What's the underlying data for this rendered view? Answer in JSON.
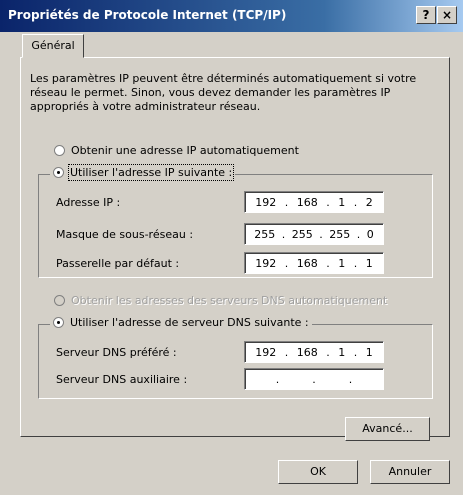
{
  "window": {
    "title": "Propriétés de Protocole Internet (TCP/IP)",
    "help_label": "?",
    "close_label": "×"
  },
  "tabs": [
    {
      "label": "Général"
    }
  ],
  "description": "Les paramètres IP peuvent être déterminés automatiquement si votre réseau le permet. Sinon, vous devez demander les paramètres IP appropriés à votre administrateur réseau.",
  "ip_section": {
    "auto_label": "Obtenir une adresse IP automatiquement",
    "manual_label": "Utiliser l'adresse IP suivante :",
    "fields": [
      {
        "label": "Adresse IP :",
        "octets": [
          "192",
          "168",
          "1",
          "2"
        ]
      },
      {
        "label": "Masque de sous-réseau :",
        "octets": [
          "255",
          "255",
          "255",
          "0"
        ]
      },
      {
        "label": "Passerelle par défaut :",
        "octets": [
          "192",
          "168",
          "1",
          "1"
        ]
      }
    ]
  },
  "dns_section": {
    "auto_label": "Obtenir les adresses des serveurs DNS automatiquement",
    "manual_label": "Utiliser l'adresse de serveur DNS suivante :",
    "fields": [
      {
        "label": "Serveur DNS préféré :",
        "octets": [
          "192",
          "168",
          "1",
          "1"
        ]
      },
      {
        "label": "Serveur DNS auxiliaire :",
        "octets": [
          "",
          "",
          "",
          ""
        ]
      }
    ]
  },
  "buttons": {
    "advanced": "Avancé...",
    "ok": "OK",
    "cancel": "Annuler"
  }
}
